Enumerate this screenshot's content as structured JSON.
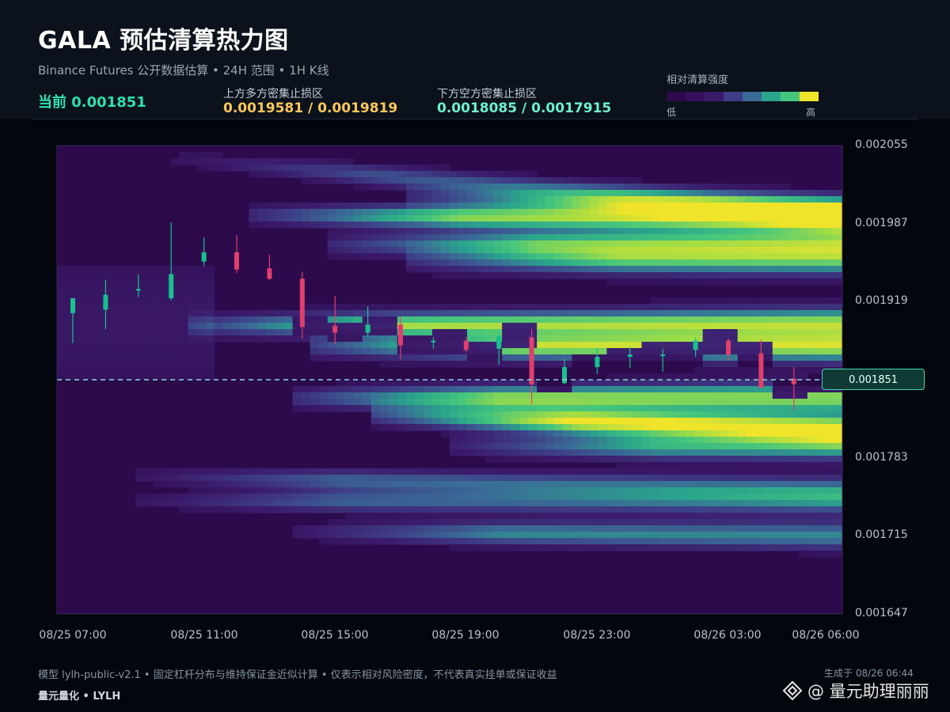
{
  "header": {
    "title": "GALA 预估清算热力图",
    "subtitle": "Binance Futures 公开数据估算 • 24H 范围 • 1H K线",
    "current_label": "当前 0.001851",
    "upper_zone_label": "上方多方密集止损区",
    "upper_zone_value": "0.0019581 / 0.0019819",
    "lower_zone_label": "下方空方密集止损区",
    "lower_zone_value": "0.0018085 / 0.0017915"
  },
  "legend": {
    "title": "相对清算强度",
    "low": "低",
    "high": "高",
    "colors": [
      "#2c0a4c",
      "#360e5b",
      "#3b1a6a",
      "#3e3c86",
      "#3a6a96",
      "#2aa58c",
      "#46c67c",
      "#f0e42a"
    ]
  },
  "price_badge": "0.001851",
  "footer": {
    "note": "模型 lylh-public-v2.1 • 固定杠杆分布与维持保证金近似计算 • 仅表示相对风险密度，不代表真实挂单或保证收益",
    "brand": "量元量化 • LYLH",
    "generated": "生成于 08/26 06:44",
    "watermark": "@ 量元助理丽丽"
  },
  "colors": {
    "up": "#19c08f",
    "down": "#e0406c",
    "current_line": "#8fd7d4",
    "current_text": "#2fe0ad",
    "upper_zone": "#ffc75a",
    "lower_zone": "#6df0cf"
  },
  "chart_data": {
    "type": "heatmap",
    "title": "GALA 预估清算热力图",
    "ylim": [
      0.001647,
      0.002055
    ],
    "y_ticks": [
      "0.002055",
      "0.001987",
      "0.001919",
      "0.001851",
      "0.001783",
      "0.001715",
      "0.001647"
    ],
    "x_ticks": [
      "08/25 07:00",
      "08/25 11:00",
      "08/25 15:00",
      "08/25 19:00",
      "08/25 23:00",
      "08/26 03:00",
      "08/26 06:00"
    ],
    "x_range_hours": [
      0,
      24
    ],
    "current_price": 0.001851,
    "candles": [
      {
        "o": 0.001909,
        "h": 0.001918,
        "l": 0.001883,
        "c": 0.001922
      },
      {
        "o": 0.001912,
        "h": 0.001938,
        "l": 0.001895,
        "c": 0.001925
      },
      {
        "o": 0.001929,
        "h": 0.001943,
        "l": 0.001923,
        "c": 0.00193
      },
      {
        "o": 0.001922,
        "h": 0.001988,
        "l": 0.00192,
        "c": 0.001943
      },
      {
        "o": 0.001954,
        "h": 0.001975,
        "l": 0.00195,
        "c": 0.001962
      },
      {
        "o": 0.001962,
        "h": 0.001977,
        "l": 0.001944,
        "c": 0.001947
      },
      {
        "o": 0.001948,
        "h": 0.00196,
        "l": 0.001938,
        "c": 0.001939
      },
      {
        "o": 0.001939,
        "h": 0.001945,
        "l": 0.001887,
        "c": 0.001897
      },
      {
        "o": 0.001898,
        "h": 0.001924,
        "l": 0.001882,
        "c": 0.001892
      },
      {
        "o": 0.001892,
        "h": 0.001915,
        "l": 0.001888,
        "c": 0.001899
      },
      {
        "o": 0.001899,
        "h": 0.001906,
        "l": 0.001869,
        "c": 0.001881
      },
      {
        "o": 0.001884,
        "h": 0.001888,
        "l": 0.001878,
        "c": 0.001885
      },
      {
        "o": 0.001885,
        "h": 0.001888,
        "l": 0.001875,
        "c": 0.001877
      },
      {
        "o": 0.001878,
        "h": 0.001892,
        "l": 0.001864,
        "c": 0.001889
      },
      {
        "o": 0.001888,
        "h": 0.001895,
        "l": 0.00183,
        "c": 0.001847
      },
      {
        "o": 0.001848,
        "h": 0.001869,
        "l": 0.001847,
        "c": 0.001862
      },
      {
        "o": 0.001862,
        "h": 0.001879,
        "l": 0.001856,
        "c": 0.001871
      },
      {
        "o": 0.001871,
        "h": 0.00188,
        "l": 0.001861,
        "c": 0.001873
      },
      {
        "o": 0.001872,
        "h": 0.001878,
        "l": 0.001858,
        "c": 0.001873
      },
      {
        "o": 0.001877,
        "h": 0.001888,
        "l": 0.001871,
        "c": 0.001885
      },
      {
        "o": 0.001885,
        "h": 0.001887,
        "l": 0.001868,
        "c": 0.001873
      },
      {
        "o": 0.001874,
        "h": 0.001886,
        "l": 0.001853,
        "c": 0.001844
      },
      {
        "o": 0.001852,
        "h": 0.001862,
        "l": 0.001824,
        "c": 0.001847
      }
    ],
    "heat_bands": [
      {
        "y0": 0.002052,
        "y1": 0.001995,
        "peak": 0.35,
        "start": 0.15,
        "label": "upper-faint"
      },
      {
        "y0": 0.00202,
        "y1": 0.002,
        "peak": 0.55,
        "start": 0.45
      },
      {
        "y0": 0.001996,
        "y1": 0.00199,
        "peak": 0.8,
        "start": 0.25
      },
      {
        "y0": 0.001968,
        "y1": 0.00197,
        "peak": 0.7,
        "start": 0.35
      },
      {
        "y0": 0.001955,
        "y1": 0.001955,
        "peak": 0.65,
        "start": 0.45
      },
      {
        "y0": 0.001898,
        "y1": 0.0019,
        "peak": 0.8,
        "start": 0.17
      },
      {
        "y0": 0.00188,
        "y1": 0.00188,
        "peak": 0.85,
        "start": 0.32
      },
      {
        "y0": 0.001835,
        "y1": 0.001835,
        "peak": 0.8,
        "start": 0.3
      },
      {
        "y0": 0.001828,
        "y1": 0.001808,
        "peak": 1.0,
        "start": 0.4
      },
      {
        "y0": 0.001793,
        "y1": 0.001793,
        "peak": 0.6,
        "start": 0.5
      },
      {
        "y0": 0.001768,
        "y1": 0.001755,
        "peak": 0.4,
        "start": 0.1
      },
      {
        "y0": 0.00172,
        "y1": 0.001715,
        "peak": 0.5,
        "start": 0.3
      },
      {
        "y0": 0.001745,
        "y1": 0.001745,
        "peak": 0.4,
        "start": 0.1
      }
    ]
  }
}
